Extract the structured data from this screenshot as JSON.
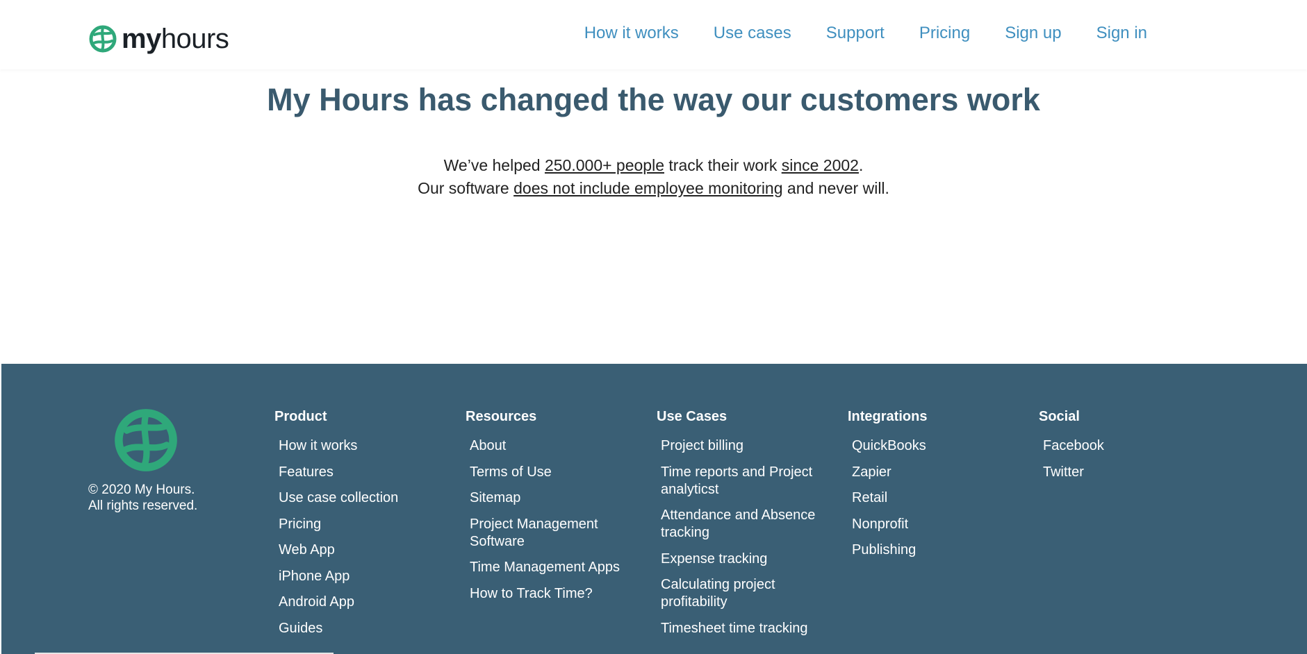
{
  "brand": {
    "name_bold": "my",
    "name_light": "hours",
    "accent": "#2fa87a"
  },
  "nav": {
    "items": [
      "How it works",
      "Use cases",
      "Support",
      "Pricing",
      "Sign up",
      "Sign in"
    ]
  },
  "hero": {
    "title": "My Hours has changed the way our customers work",
    "line1_a": "We’ve helped ",
    "line1_link1": "250.000+ people",
    "line1_b": " track their work ",
    "line1_link2": "since 2002",
    "line1_c": ".",
    "line2_a": "Our software ",
    "line2_link": "does not include employee monitoring",
    "line2_b": " and never will."
  },
  "footer": {
    "copyright_line1": "© 2020 My Hours.",
    "copyright_line2": "All rights reserved.",
    "product": {
      "heading": "Product",
      "items": [
        "How it works",
        "Features",
        "Use case collection",
        "Pricing",
        "Web App",
        "iPhone App",
        "Android App",
        "Guides"
      ]
    },
    "resources": {
      "heading": "Resources",
      "items": [
        "About",
        "Terms of Use",
        "Sitemap",
        "Project Management Software",
        "Time Management Apps",
        "How to Track Time?"
      ]
    },
    "use_cases": {
      "heading": "Use Cases",
      "items": [
        "Project billing",
        "Time reports and Project analyticst",
        "Attendance and Absence tracking",
        "Expense tracking",
        "Calculating project profitability",
        "Timesheet time tracking"
      ]
    },
    "integrations": {
      "heading": "Integrations",
      "items": [
        "QuickBooks",
        "Zapier",
        "Retail",
        "Nonprofit",
        "Publishing"
      ]
    },
    "social": {
      "heading": "Social",
      "items": [
        "Facebook",
        "Twitter"
      ]
    },
    "colors": {
      "background": "#3a5f75",
      "text": "#ffffff"
    }
  }
}
